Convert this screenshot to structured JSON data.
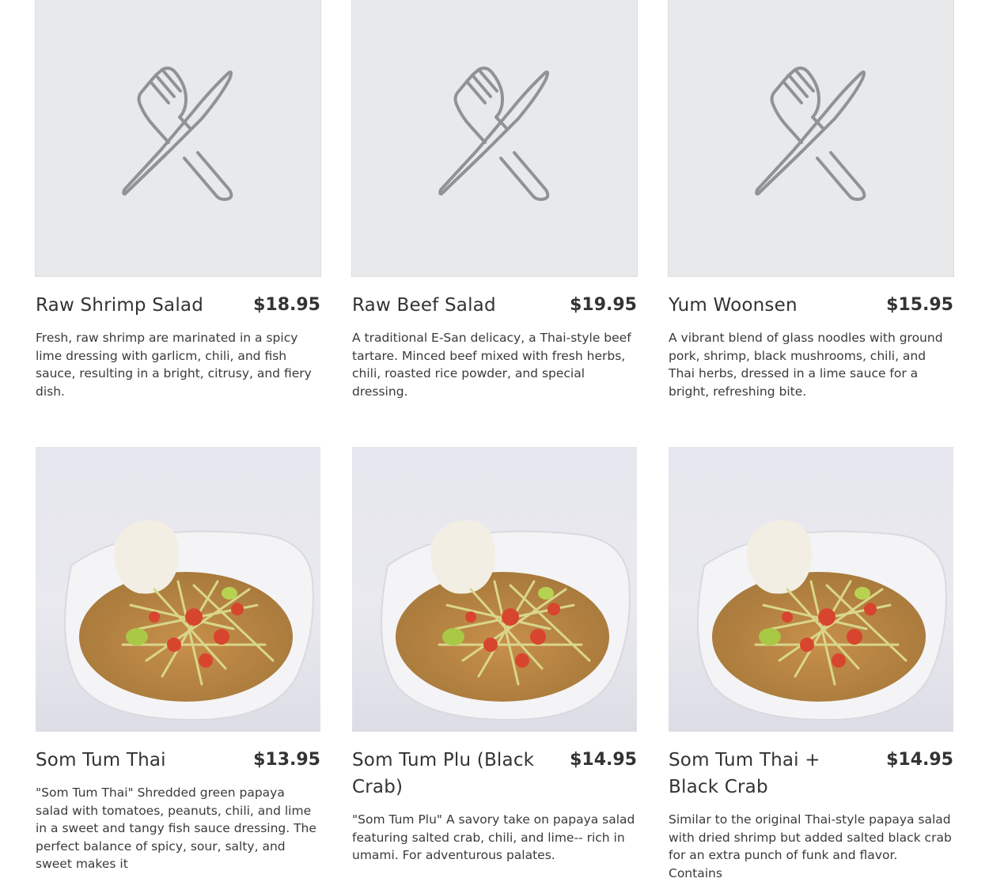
{
  "menu": {
    "items": [
      {
        "name": "Raw Shrimp Salad",
        "price": "$18.95",
        "description": "Fresh, raw shrimp are marinated in a spicy lime dressing with garlicm, chili, and fish sauce, resulting in a bright, citrusy, and fiery dish.",
        "image": "placeholder-utensils-icon"
      },
      {
        "name": "Raw Beef Salad",
        "price": "$19.95",
        "description": "A traditional E-San delicacy, a Thai-style beef tartare. Minced beef mixed with fresh herbs, chili, roasted rice powder, and special dressing.",
        "image": "placeholder-utensils-icon"
      },
      {
        "name": "Yum Woonsen",
        "price": "$15.95",
        "description": "A vibrant blend of glass noodles with ground pork, shrimp, black mushrooms, chili, and Thai herbs, dressed in a lime sauce for a bright, refreshing bite.",
        "image": "placeholder-utensils-icon"
      },
      {
        "name": "Som Tum Thai",
        "price": "$13.95",
        "description": "\"Som Tum Thai\" Shredded green papaya salad with tomatoes, peanuts, chili, and lime in a sweet and tangy fish sauce dressing. The perfect balance of spicy, sour, salty, and sweet makes it",
        "image": "papaya-salad-photo"
      },
      {
        "name": "Som Tum Plu (Black Crab)",
        "price": "$14.95",
        "description": "\"Som Tum Plu\" A savory take on papaya salad featuring salted crab, chili, and lime-- rich in umami. For adventurous palates.",
        "image": "papaya-salad-photo"
      },
      {
        "name": "Som Tum Thai + Black Crab",
        "price": "$14.95",
        "description": "Similar to the original Thai-style papaya salad with dried shrimp but added salted black crab for an extra punch of funk and flavor. Contains",
        "image": "papaya-salad-photo"
      }
    ]
  },
  "colors": {
    "placeholder_bg": "#e8e9ea",
    "icon_stroke": "#8f9397",
    "text": "#333333"
  }
}
